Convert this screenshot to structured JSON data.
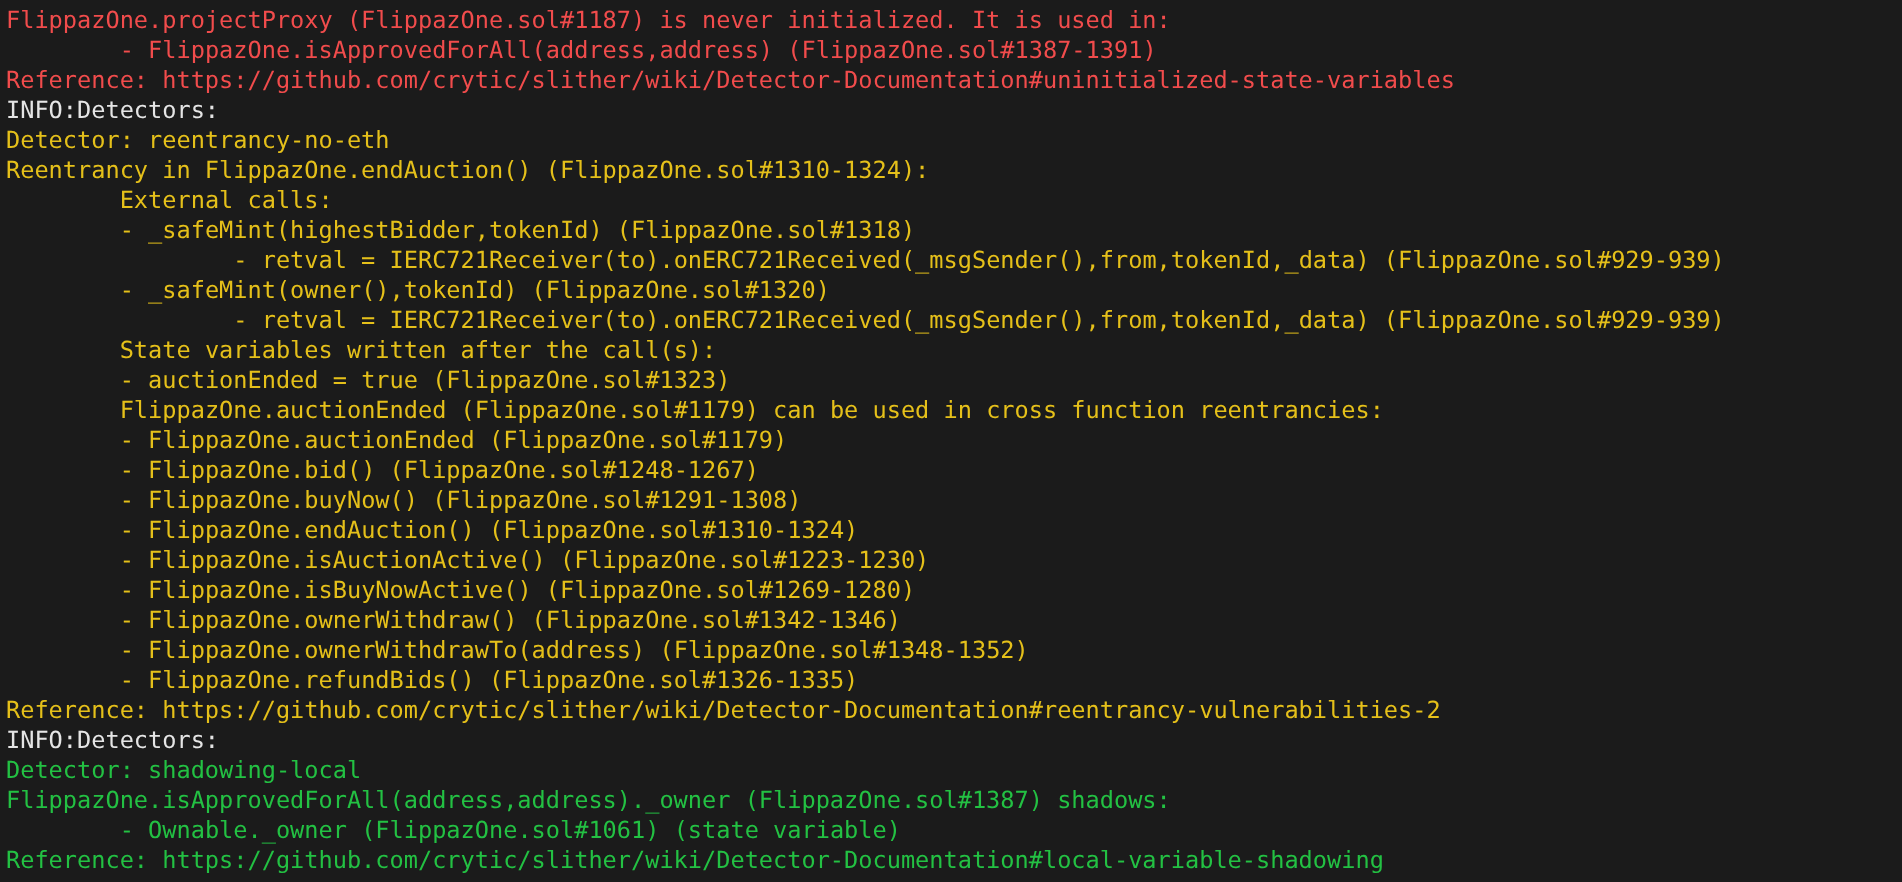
{
  "terminal": {
    "lines": [
      {
        "text": "FlippazOne.projectProxy (FlippazOne.sol#1187) is never initialized. It is used in:",
        "color": "#f14c4c"
      },
      {
        "text": "\t- FlippazOne.isApprovedForAll(address,address) (FlippazOne.sol#1387-1391)",
        "color": "#f14c4c"
      },
      {
        "text": "Reference: https://github.com/crytic/slither/wiki/Detector-Documentation#uninitialized-state-variables",
        "color": "#f14c4c"
      },
      {
        "text": "INFO:Detectors:",
        "color": "#e5e5e5"
      },
      {
        "text": "Detector: reentrancy-no-eth",
        "color": "#e5c01a"
      },
      {
        "text": "Reentrancy in FlippazOne.endAuction() (FlippazOne.sol#1310-1324):",
        "color": "#e5c01a"
      },
      {
        "text": "\tExternal calls:",
        "color": "#e5c01a"
      },
      {
        "text": "\t- _safeMint(highestBidder,tokenId) (FlippazOne.sol#1318)",
        "color": "#e5c01a"
      },
      {
        "text": "\t\t- retval = IERC721Receiver(to).onERC721Received(_msgSender(),from,tokenId,_data) (FlippazOne.sol#929-939)",
        "color": "#e5c01a"
      },
      {
        "text": "\t- _safeMint(owner(),tokenId) (FlippazOne.sol#1320)",
        "color": "#e5c01a"
      },
      {
        "text": "\t\t- retval = IERC721Receiver(to).onERC721Received(_msgSender(),from,tokenId,_data) (FlippazOne.sol#929-939)",
        "color": "#e5c01a"
      },
      {
        "text": "\tState variables written after the call(s):",
        "color": "#e5c01a"
      },
      {
        "text": "\t- auctionEnded = true (FlippazOne.sol#1323)",
        "color": "#e5c01a"
      },
      {
        "text": "\tFlippazOne.auctionEnded (FlippazOne.sol#1179) can be used in cross function reentrancies:",
        "color": "#e5c01a"
      },
      {
        "text": "\t- FlippazOne.auctionEnded (FlippazOne.sol#1179)",
        "color": "#e5c01a"
      },
      {
        "text": "\t- FlippazOne.bid() (FlippazOne.sol#1248-1267)",
        "color": "#e5c01a"
      },
      {
        "text": "\t- FlippazOne.buyNow() (FlippazOne.sol#1291-1308)",
        "color": "#e5c01a"
      },
      {
        "text": "\t- FlippazOne.endAuction() (FlippazOne.sol#1310-1324)",
        "color": "#e5c01a"
      },
      {
        "text": "\t- FlippazOne.isAuctionActive() (FlippazOne.sol#1223-1230)",
        "color": "#e5c01a"
      },
      {
        "text": "\t- FlippazOne.isBuyNowActive() (FlippazOne.sol#1269-1280)",
        "color": "#e5c01a"
      },
      {
        "text": "\t- FlippazOne.ownerWithdraw() (FlippazOne.sol#1342-1346)",
        "color": "#e5c01a"
      },
      {
        "text": "\t- FlippazOne.ownerWithdrawTo(address) (FlippazOne.sol#1348-1352)",
        "color": "#e5c01a"
      },
      {
        "text": "\t- FlippazOne.refundBids() (FlippazOne.sol#1326-1335)",
        "color": "#e5c01a"
      },
      {
        "text": "Reference: https://github.com/crytic/slither/wiki/Detector-Documentation#reentrancy-vulnerabilities-2",
        "color": "#e5c01a"
      },
      {
        "text": "INFO:Detectors:",
        "color": "#e5e5e5"
      },
      {
        "text": "Detector: shadowing-local",
        "color": "#23c143"
      },
      {
        "text": "FlippazOne.isApprovedForAll(address,address)._owner (FlippazOne.sol#1387) shadows:",
        "color": "#23c143"
      },
      {
        "text": "\t- Ownable._owner (FlippazOne.sol#1061) (state variable)",
        "color": "#23c143"
      },
      {
        "text": "Reference: https://github.com/crytic/slither/wiki/Detector-Documentation#local-variable-shadowing",
        "color": "#23c143"
      }
    ]
  }
}
